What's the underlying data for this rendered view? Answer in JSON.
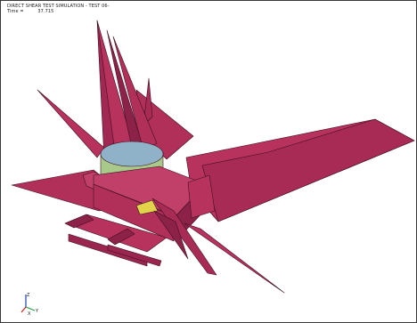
{
  "header": {
    "title": "DIRECT SHEAR TEST SIMULATION - TEST 06-",
    "time_label": "Time =",
    "time_value": "37.715"
  },
  "triad": {
    "z_label": "Z",
    "y_label": "Y",
    "x_label": "X"
  },
  "colors": {
    "plate": "#b8325e",
    "plate_dark": "#7d1f3f",
    "edge": "#3d0f20",
    "cylinder": "#a9c98a",
    "cylinder_top": "#8fb2c8",
    "insert": "#e2d44a",
    "background": "#ffffff"
  },
  "icons": {
    "view": "3d-model-render",
    "triad": "axis-triad-icon"
  }
}
